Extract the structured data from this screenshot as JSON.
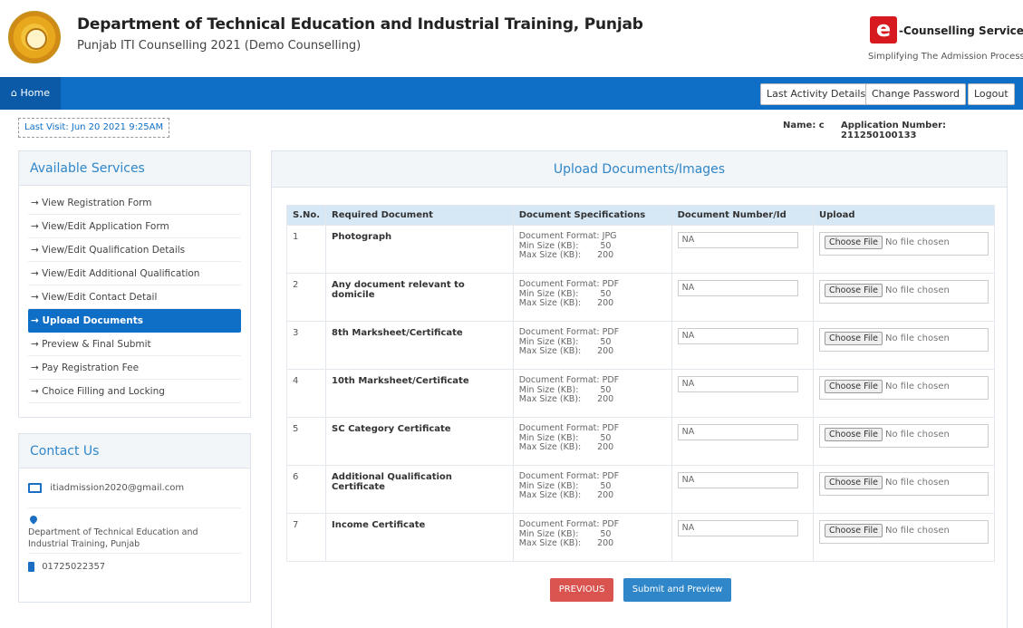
{
  "header": {
    "title": "Department of Technical Education and Industrial Training, Punjab",
    "subtitle": "Punjab ITI Counselling 2021 (Demo Counselling)",
    "brand_mark": "e",
    "brand_name": "-Counselling Services",
    "brand_tagline": "Simplifying The Admission Process"
  },
  "nav": {
    "home": "Home",
    "last_activity": "Last Activity Details",
    "change_password": "Change Password",
    "logout": "Logout"
  },
  "subbar": {
    "last_visit": "Last Visit: Jun 20 2021 9:25AM",
    "name": "Name: c",
    "application_number": "Application Number: 211250100133"
  },
  "sidebar": {
    "title": "Available Services",
    "items": [
      {
        "label": "View Registration Form"
      },
      {
        "label": "View/Edit Application Form"
      },
      {
        "label": "View/Edit Qualification Details"
      },
      {
        "label": "View/Edit Additional Qualification"
      },
      {
        "label": "View/Edit Contact Detail"
      },
      {
        "label": "Upload Documents"
      },
      {
        "label": "Preview & Final Submit"
      },
      {
        "label": "Pay Registration Fee"
      },
      {
        "label": "Choice Filling and Locking"
      }
    ]
  },
  "contact": {
    "title": "Contact Us",
    "email": "itiadmission2020@gmail.com",
    "address": "Department of Technical Education and Industrial Training, Punjab",
    "phone": "01725022357"
  },
  "main": {
    "title": "Upload Documents/Images",
    "columns": [
      "S.No.",
      "Required Document",
      "Document Specifications",
      "Document Number/Id",
      "Upload"
    ],
    "spec_labels": {
      "format": "Document Format:",
      "min": "Min Size (KB):",
      "max": "Max Size (KB):"
    },
    "file_button": "Choose File",
    "file_status": "No file chosen",
    "rows": [
      {
        "sno": "1",
        "doc": "Photograph",
        "format": "JPG",
        "min": "50",
        "max": "200",
        "number": "NA"
      },
      {
        "sno": "2",
        "doc": "Any document relevant to domicile",
        "format": "PDF",
        "min": "50",
        "max": "200",
        "number": "NA"
      },
      {
        "sno": "3",
        "doc": "8th Marksheet/Certificate",
        "format": "PDF",
        "min": "50",
        "max": "200",
        "number": "NA"
      },
      {
        "sno": "4",
        "doc": "10th Marksheet/Certificate",
        "format": "PDF",
        "min": "50",
        "max": "200",
        "number": "NA"
      },
      {
        "sno": "5",
        "doc": "SC Category Certificate",
        "format": "PDF",
        "min": "50",
        "max": "200",
        "number": "NA"
      },
      {
        "sno": "6",
        "doc": "Additional Qualification Certificate",
        "format": "PDF",
        "min": "50",
        "max": "200",
        "number": "NA"
      },
      {
        "sno": "7",
        "doc": "Income Certificate",
        "format": "PDF",
        "min": "50",
        "max": "200",
        "number": "NA"
      }
    ],
    "previous_button": "PREVIOUS",
    "submit_button": "Submit and Preview"
  },
  "colors": {
    "navbar": "#0f6fc6",
    "previous": "#d9534f",
    "submit": "#2f86c8"
  }
}
